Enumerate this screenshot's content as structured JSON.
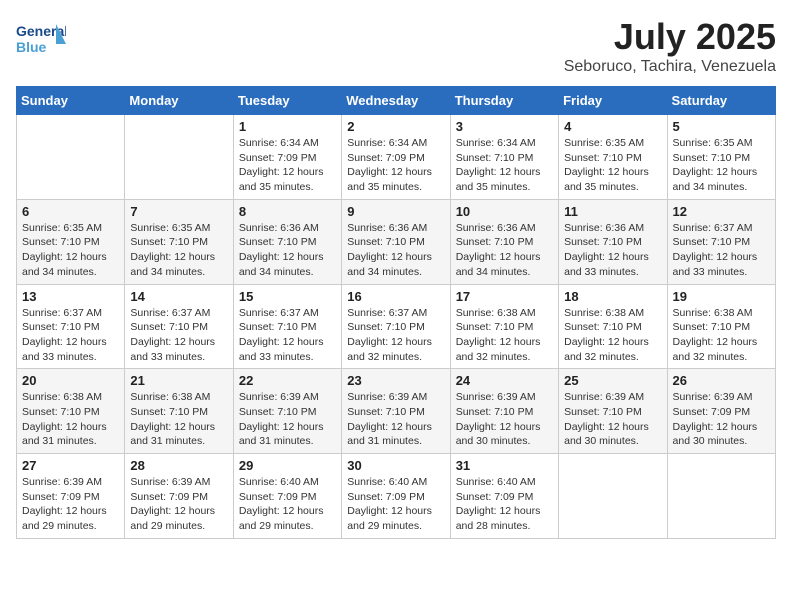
{
  "header": {
    "logo_line1": "General",
    "logo_line2": "Blue",
    "month_year": "July 2025",
    "location": "Seboruco, Tachira, Venezuela"
  },
  "days_of_week": [
    "Sunday",
    "Monday",
    "Tuesday",
    "Wednesday",
    "Thursday",
    "Friday",
    "Saturday"
  ],
  "weeks": [
    [
      {
        "day": "",
        "info": ""
      },
      {
        "day": "",
        "info": ""
      },
      {
        "day": "1",
        "info": "Sunrise: 6:34 AM\nSunset: 7:09 PM\nDaylight: 12 hours and 35 minutes."
      },
      {
        "day": "2",
        "info": "Sunrise: 6:34 AM\nSunset: 7:09 PM\nDaylight: 12 hours and 35 minutes."
      },
      {
        "day": "3",
        "info": "Sunrise: 6:34 AM\nSunset: 7:10 PM\nDaylight: 12 hours and 35 minutes."
      },
      {
        "day": "4",
        "info": "Sunrise: 6:35 AM\nSunset: 7:10 PM\nDaylight: 12 hours and 35 minutes."
      },
      {
        "day": "5",
        "info": "Sunrise: 6:35 AM\nSunset: 7:10 PM\nDaylight: 12 hours and 34 minutes."
      }
    ],
    [
      {
        "day": "6",
        "info": "Sunrise: 6:35 AM\nSunset: 7:10 PM\nDaylight: 12 hours and 34 minutes."
      },
      {
        "day": "7",
        "info": "Sunrise: 6:35 AM\nSunset: 7:10 PM\nDaylight: 12 hours and 34 minutes."
      },
      {
        "day": "8",
        "info": "Sunrise: 6:36 AM\nSunset: 7:10 PM\nDaylight: 12 hours and 34 minutes."
      },
      {
        "day": "9",
        "info": "Sunrise: 6:36 AM\nSunset: 7:10 PM\nDaylight: 12 hours and 34 minutes."
      },
      {
        "day": "10",
        "info": "Sunrise: 6:36 AM\nSunset: 7:10 PM\nDaylight: 12 hours and 34 minutes."
      },
      {
        "day": "11",
        "info": "Sunrise: 6:36 AM\nSunset: 7:10 PM\nDaylight: 12 hours and 33 minutes."
      },
      {
        "day": "12",
        "info": "Sunrise: 6:37 AM\nSunset: 7:10 PM\nDaylight: 12 hours and 33 minutes."
      }
    ],
    [
      {
        "day": "13",
        "info": "Sunrise: 6:37 AM\nSunset: 7:10 PM\nDaylight: 12 hours and 33 minutes."
      },
      {
        "day": "14",
        "info": "Sunrise: 6:37 AM\nSunset: 7:10 PM\nDaylight: 12 hours and 33 minutes."
      },
      {
        "day": "15",
        "info": "Sunrise: 6:37 AM\nSunset: 7:10 PM\nDaylight: 12 hours and 33 minutes."
      },
      {
        "day": "16",
        "info": "Sunrise: 6:37 AM\nSunset: 7:10 PM\nDaylight: 12 hours and 32 minutes."
      },
      {
        "day": "17",
        "info": "Sunrise: 6:38 AM\nSunset: 7:10 PM\nDaylight: 12 hours and 32 minutes."
      },
      {
        "day": "18",
        "info": "Sunrise: 6:38 AM\nSunset: 7:10 PM\nDaylight: 12 hours and 32 minutes."
      },
      {
        "day": "19",
        "info": "Sunrise: 6:38 AM\nSunset: 7:10 PM\nDaylight: 12 hours and 32 minutes."
      }
    ],
    [
      {
        "day": "20",
        "info": "Sunrise: 6:38 AM\nSunset: 7:10 PM\nDaylight: 12 hours and 31 minutes."
      },
      {
        "day": "21",
        "info": "Sunrise: 6:38 AM\nSunset: 7:10 PM\nDaylight: 12 hours and 31 minutes."
      },
      {
        "day": "22",
        "info": "Sunrise: 6:39 AM\nSunset: 7:10 PM\nDaylight: 12 hours and 31 minutes."
      },
      {
        "day": "23",
        "info": "Sunrise: 6:39 AM\nSunset: 7:10 PM\nDaylight: 12 hours and 31 minutes."
      },
      {
        "day": "24",
        "info": "Sunrise: 6:39 AM\nSunset: 7:10 PM\nDaylight: 12 hours and 30 minutes."
      },
      {
        "day": "25",
        "info": "Sunrise: 6:39 AM\nSunset: 7:10 PM\nDaylight: 12 hours and 30 minutes."
      },
      {
        "day": "26",
        "info": "Sunrise: 6:39 AM\nSunset: 7:09 PM\nDaylight: 12 hours and 30 minutes."
      }
    ],
    [
      {
        "day": "27",
        "info": "Sunrise: 6:39 AM\nSunset: 7:09 PM\nDaylight: 12 hours and 29 minutes."
      },
      {
        "day": "28",
        "info": "Sunrise: 6:39 AM\nSunset: 7:09 PM\nDaylight: 12 hours and 29 minutes."
      },
      {
        "day": "29",
        "info": "Sunrise: 6:40 AM\nSunset: 7:09 PM\nDaylight: 12 hours and 29 minutes."
      },
      {
        "day": "30",
        "info": "Sunrise: 6:40 AM\nSunset: 7:09 PM\nDaylight: 12 hours and 29 minutes."
      },
      {
        "day": "31",
        "info": "Sunrise: 6:40 AM\nSunset: 7:09 PM\nDaylight: 12 hours and 28 minutes."
      },
      {
        "day": "",
        "info": ""
      },
      {
        "day": "",
        "info": ""
      }
    ]
  ]
}
